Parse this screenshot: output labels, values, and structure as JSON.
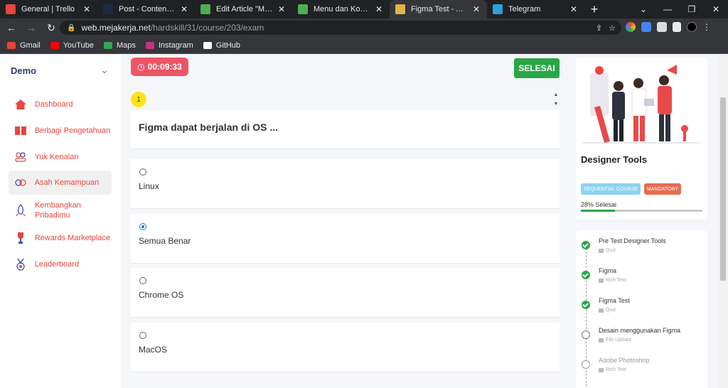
{
  "browser": {
    "tabs": [
      {
        "title": "General | Trello",
        "favicon": "trello-icon",
        "color": "#e8453c",
        "active": false
      },
      {
        "title": "Post - Content - Graph",
        "favicon": "graph-icon",
        "color": "#1f2a44",
        "active": false
      },
      {
        "title": "Edit Article \"Menu dan",
        "favicon": "article-icon",
        "color": "#4caf50",
        "active": false
      },
      {
        "title": "Menu dan Konten – M",
        "favicon": "article-icon",
        "color": "#4caf50",
        "active": false
      },
      {
        "title": "Figma Test - Asah Kem",
        "favicon": "mejakerja-icon",
        "color": "#e0b34a",
        "active": true
      },
      {
        "title": "Telegram",
        "favicon": "telegram-icon",
        "color": "#2aa3df",
        "active": false
      }
    ],
    "url_host": "web.mejakerja.net",
    "url_path": "/hardskill/31/course/203/exam",
    "bookmarks": [
      {
        "label": "Gmail",
        "color": "#ea4335"
      },
      {
        "label": "YouTube",
        "color": "#ff0000"
      },
      {
        "label": "Maps",
        "color": "#34a853"
      },
      {
        "label": "Instagram",
        "color": "#c13584"
      },
      {
        "label": "GitHub",
        "color": "#ffffff"
      }
    ]
  },
  "sidebar": {
    "brand": "Demo",
    "items": [
      {
        "label": "Dashboard",
        "icon": "home-icon",
        "active": false
      },
      {
        "label": "Berbagi Pengetahuan",
        "icon": "book-icon",
        "active": false
      },
      {
        "label": "Yuk Kenalan",
        "icon": "people-icon",
        "active": false
      },
      {
        "label": "Asah Kemampuan",
        "icon": "skills-icon",
        "active": true
      },
      {
        "label": "Kembangkan Pribadimu",
        "icon": "rocket-icon",
        "active": false
      },
      {
        "label": "Rewards Marketplace",
        "icon": "trophy-icon",
        "active": false
      },
      {
        "label": "Leaderboard",
        "icon": "medal-icon",
        "active": false
      }
    ],
    "accent": "#e8453c"
  },
  "exam": {
    "timer": "00:09:33",
    "finish_label": "SELESAI",
    "question_number": "1",
    "question": "Figma dapat berjalan di OS ...",
    "options": [
      {
        "label": "Linux",
        "selected": false
      },
      {
        "label": "Semua Benar",
        "selected": true
      },
      {
        "label": "Chrome OS",
        "selected": false
      },
      {
        "label": "MacOS",
        "selected": false
      }
    ]
  },
  "course": {
    "title": "Designer Tools",
    "badges": [
      "SEQUENTIAL COURSE",
      "MANDATORY"
    ],
    "progress_label": "28% Selesai",
    "progress": 0.28,
    "steps": [
      {
        "title": "Pre Test Designer Tools",
        "type": "Quiz",
        "state": "done"
      },
      {
        "title": "Figma",
        "type": "Rich Text",
        "state": "done"
      },
      {
        "title": "Figma Test",
        "type": "Quiz",
        "state": "done"
      },
      {
        "title": "Desain menggunakan Figma",
        "type": "File Upload",
        "state": "open"
      },
      {
        "title": "Adobe Photoshop",
        "type": "Rich Text",
        "state": "locked"
      }
    ]
  }
}
